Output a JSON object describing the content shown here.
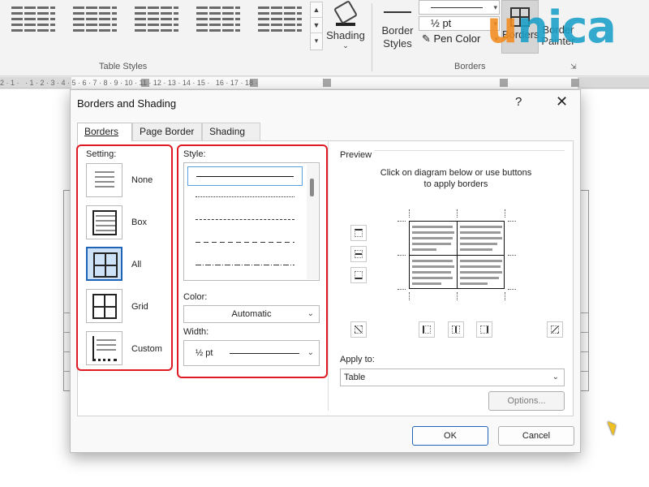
{
  "ribbon": {
    "shading_label": "Shading",
    "border_styles_label": "Border Styles",
    "pen_weight": "½ pt",
    "pen_color_label": "Pen Color",
    "borders_label": "Borders",
    "painter_label": "Border Painter",
    "group_table_styles": "Table Styles",
    "group_borders": "Borders",
    "logo_text": "unica"
  },
  "ruler": {
    "numbers": "2 · 1 ·   · 1 · 2 · 3 · 4 · 5 · 6 · 7 · 8 · 9 · 10 · 11 · 12 · 13 · 14 · 15 ·   16 · 17 · 18 ·"
  },
  "dialog": {
    "title": "Borders and Shading",
    "help": "?",
    "close": "✕",
    "tabs": [
      "Borders",
      "Page Border",
      "Shading"
    ],
    "setting": {
      "label": "Setting:",
      "options": [
        "None",
        "Box",
        "All",
        "Grid",
        "Custom"
      ],
      "selected": "All"
    },
    "style": {
      "label": "Style:",
      "items": [
        "solid",
        "dotted",
        "dashed-small",
        "dashed",
        "dash-dot"
      ],
      "selected": "solid"
    },
    "color": {
      "label": "Color:",
      "value": "Automatic"
    },
    "width": {
      "label": "Width:",
      "value": "½ pt"
    },
    "preview": {
      "label": "Preview",
      "instruction_line1": "Click on diagram below or use buttons",
      "instruction_line2": "to apply borders"
    },
    "apply_to": {
      "label": "Apply to:",
      "value": "Table"
    },
    "options_button": "Options...",
    "ok_button": "OK",
    "cancel_button": "Cancel"
  },
  "colors": {
    "highlight_red": "#e01a25",
    "selection_blue": "#1f63b6",
    "logo_blue": "#19a0c8",
    "logo_orange": "#f28c1f"
  }
}
